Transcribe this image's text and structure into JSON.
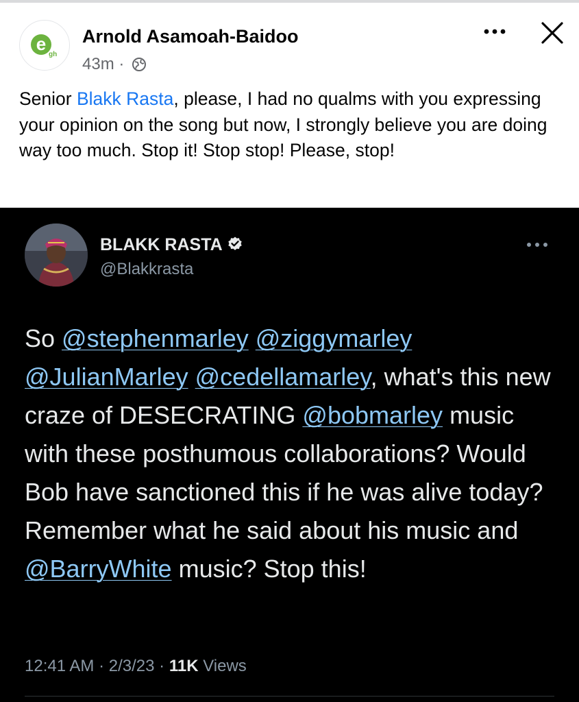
{
  "post": {
    "author": "Arnold Asamoah-Baidoo",
    "time": "43m",
    "separator": "·",
    "avatar_icon": "egh-logo-icon",
    "avatar_letter": "e",
    "avatar_sub": "gh",
    "audience_icon": "globe-icon",
    "more_icon": "more-horizontal-icon",
    "close_icon": "close-icon",
    "text": {
      "before": "Senior ",
      "mention": "Blakk Rasta",
      "after": ", please, I had no qualms with you expressing your opinion on the song but now, I strongly believe you are doing way too much. Stop it! Stop stop! Please, stop!"
    }
  },
  "tweet": {
    "name": "BLAKK RASTA",
    "handle": "@Blakkrasta",
    "verified_icon": "verified-badge-icon",
    "more_icon": "more-horizontal-icon",
    "body": [
      {
        "t": "So "
      },
      {
        "t": "@stephenmarley",
        "link": true
      },
      {
        "t": " "
      },
      {
        "t": "@ziggymarley",
        "link": true
      },
      {
        "t": " "
      },
      {
        "t": "@JulianMarley",
        "link": true
      },
      {
        "t": " "
      },
      {
        "t": "@cedellamarley",
        "link": true
      },
      {
        "t": ", what's this new craze of DESECRATING "
      },
      {
        "t": "@bobmarley",
        "link": true
      },
      {
        "t": " music with these posthumous collaborations? Would Bob have sanctioned this if he was alive today? Remember what he said about his music and "
      },
      {
        "t": "@BarryWhite",
        "link": true
      },
      {
        "t": " music? Stop this!"
      }
    ],
    "time": "12:41 AM",
    "date": "2/3/23",
    "separator": "·",
    "views_count": "11K",
    "views_label": "Views"
  },
  "colors": {
    "mention_blue": "#1877f2",
    "tweet_link": "#8ec8f5",
    "tweet_background": "#000000",
    "verified_blue": "#1d9bf0"
  }
}
